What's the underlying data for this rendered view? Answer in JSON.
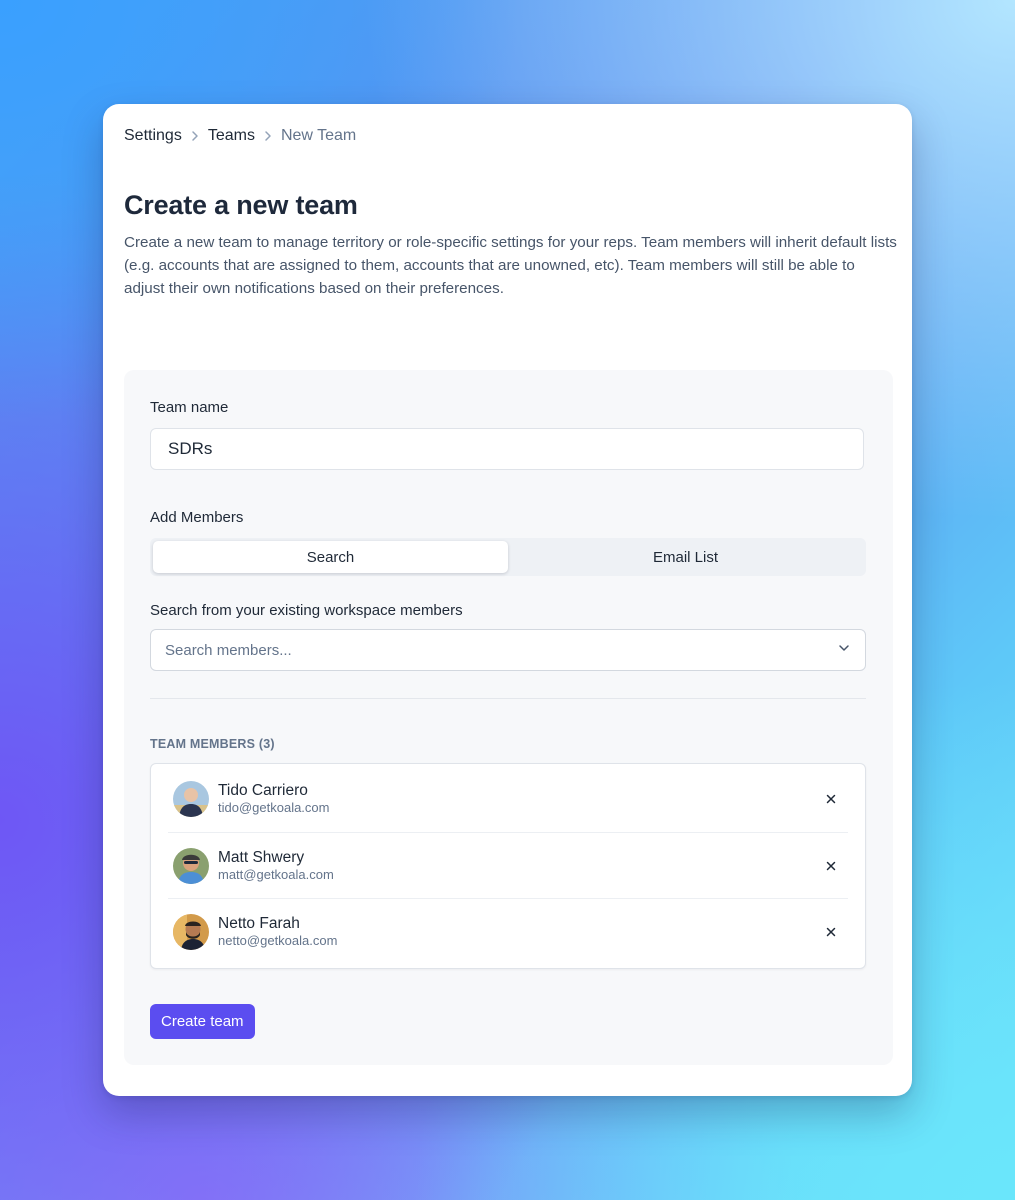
{
  "breadcrumb": {
    "items": [
      "Settings",
      "Teams",
      "New Team"
    ]
  },
  "page": {
    "title": "Create a new team",
    "description": "Create a new team to manage territory or role-specific settings for your reps. Team members will inherit default lists (e.g. accounts that are assigned to them, accounts that are unowned, etc). Team members will still be able to adjust their own notifications based on their preferences."
  },
  "form": {
    "team_name_label": "Team name",
    "team_name_value": "SDRs",
    "add_members_label": "Add Members",
    "tabs": [
      {
        "label": "Search",
        "active": true
      },
      {
        "label": "Email List",
        "active": false
      }
    ],
    "search_label": "Search from your existing workspace members",
    "search_placeholder": "Search members...",
    "members_heading": "TEAM MEMBERS (3)",
    "members": [
      {
        "name": "Tido Carriero",
        "email": "tido@getkoala.com"
      },
      {
        "name": "Matt Shwery",
        "email": "matt@getkoala.com"
      },
      {
        "name": "Netto Farah",
        "email": "netto@getkoala.com"
      }
    ],
    "submit_label": "Create team"
  },
  "icons": {
    "breadcrumb_separator": "chevron-right-icon",
    "select_toggle": "chevron-down-icon",
    "remove_member": "close-icon"
  },
  "colors": {
    "primary_button": "#5b4df0",
    "panel_background": "#f7f8fa"
  }
}
